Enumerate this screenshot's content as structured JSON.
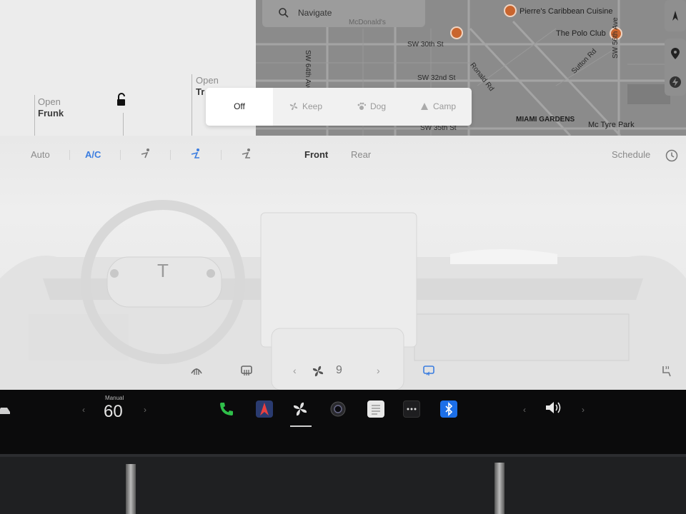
{
  "car_status": {
    "frunk": {
      "state": "Open",
      "label": "Frunk"
    },
    "trunk": {
      "state": "Open",
      "label": "Tr"
    }
  },
  "map": {
    "search_placeholder": "Navigate",
    "pois": [
      {
        "name": "Pierre's Caribbean Cuisine"
      },
      {
        "name": "The Polo Club"
      },
      {
        "name": "McDonald's"
      }
    ],
    "streets": [
      "SW 30th St",
      "SW 32nd St",
      "SW 35th St",
      "SW 64th Ave",
      "SW 56th Ave",
      "Ronald Rd",
      "Sutton Rd"
    ],
    "area": "MIAMI GARDENS",
    "park": "Mc Tyre Park"
  },
  "climate": {
    "auto_label": "Auto",
    "ac_label": "A/C",
    "front_label": "Front",
    "rear_label": "Rear",
    "schedule_label": "Schedule",
    "fan_speed": "9",
    "keep_modes": [
      "Off",
      "Keep",
      "Dog",
      "Camp"
    ],
    "selected_mode": "Off",
    "accent": "#3b7de0"
  },
  "dock": {
    "drive_mode": "Manual",
    "speed": "60"
  },
  "icons": [
    "search-icon",
    "pin-icon",
    "lightning-icon",
    "lock-icon",
    "clock-icon",
    "fan-icon",
    "phone-icon",
    "navigation-icon",
    "camera-icon",
    "notes-icon",
    "more-icon",
    "bluetooth-icon",
    "volume-icon",
    "seat-heat-icon",
    "defrost-icon",
    "recirculate-icon"
  ]
}
